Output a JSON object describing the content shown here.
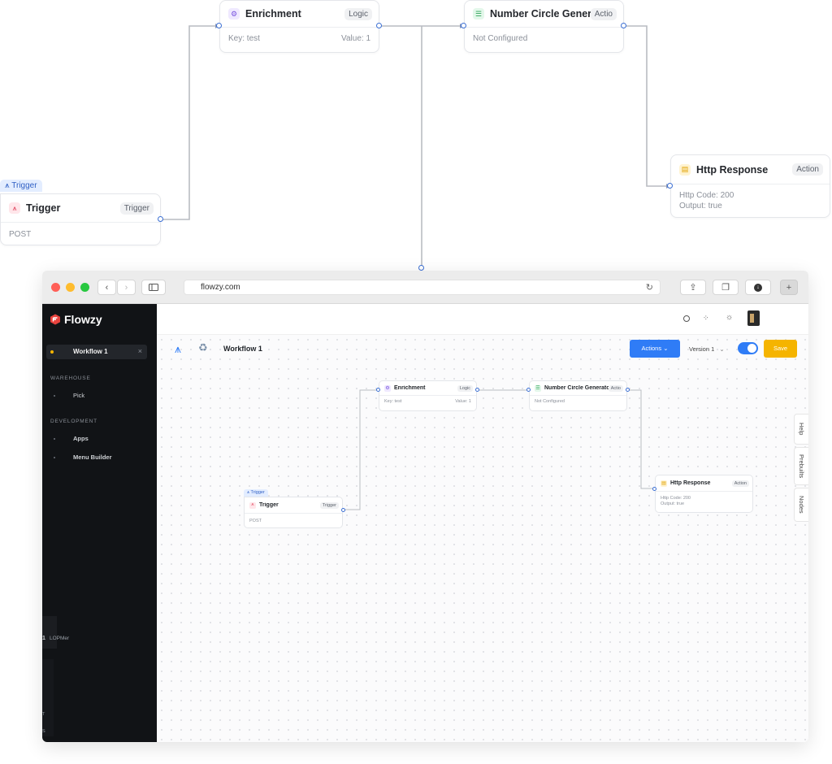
{
  "outer": {
    "enrichment": {
      "title": "Enrichment",
      "tag": "Logic",
      "key": "Key: test",
      "value": "Value: 1"
    },
    "number_circle": {
      "title": "Number Circle Generator",
      "tag": "Actio",
      "body": "Not Configured"
    },
    "http_response": {
      "title": "Http Response",
      "tag": "Action",
      "line1": "Http Code: 200",
      "line2": "Output: true"
    },
    "trigger": {
      "label": "Trigger",
      "title": "Trigger",
      "tag": "Trigger",
      "body": "POST"
    }
  },
  "browser": {
    "url": "flowzy.com",
    "back_icon": "chevron-left-icon",
    "forward_icon": "chevron-right-icon"
  },
  "sidebar": {
    "brand": "Flowzy",
    "active_workflow": "Workflow 1",
    "sections": [
      {
        "title": "WAREHOUSE",
        "items": [
          "Pick"
        ]
      },
      {
        "title": "DEVELOPMENT",
        "items": [
          "Apps",
          "Menu Builder"
        ]
      }
    ],
    "ghost_texts": [
      "1",
      "LOPMer",
      "T",
      "S"
    ]
  },
  "toolbar": {
    "workflow_title": "Workflow 1",
    "actions_label": "Actions",
    "version_label": "Version 1",
    "save_label": "Save"
  },
  "inner": {
    "enrichment": {
      "title": "Enrichment",
      "tag": "Logic",
      "key": "Key: test",
      "value": "Value: 1"
    },
    "number_circle": {
      "title": "Number Circle Generator",
      "tag": "Actio",
      "body": "Not Configured"
    },
    "http_response": {
      "title": "Http Response",
      "tag": "Action",
      "line1": "Http Code: 200",
      "line2": "Output: true"
    },
    "trigger": {
      "label": "Trigger",
      "title": "Trigger",
      "tag": "Trigger",
      "body": "POST"
    }
  },
  "right_tabs": [
    "Help",
    "Prebuilts",
    "Nodes"
  ],
  "colors": {
    "accent": "#2f7cf6",
    "save": "#f5b400",
    "sidebar_bg": "#111316",
    "brand_red": "#e8433e",
    "connector": "#b9bcc2"
  }
}
